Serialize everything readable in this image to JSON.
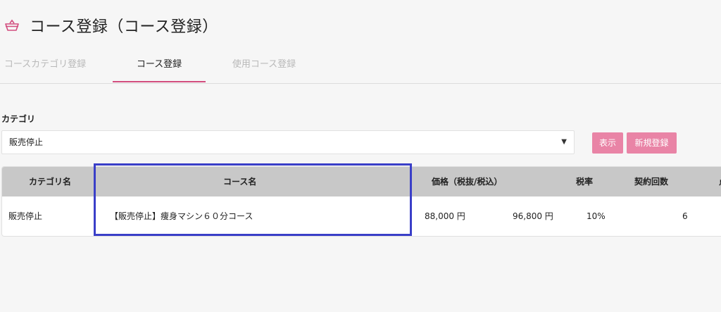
{
  "page": {
    "title": "コース登録（コース登録）"
  },
  "tabs": [
    "コースカテゴリ登録",
    "コース登録",
    "使用コース登録"
  ],
  "filter": {
    "label": "カテゴリ",
    "selected": "販売停止",
    "arrow": "▼"
  },
  "buttons": {
    "show": "表示",
    "new": "新規登録"
  },
  "table": {
    "headers": {
      "category": "カテゴリ名",
      "course": "コース名",
      "price": "価格（税抜/税込）",
      "tax_rate": "税率",
      "contracts": "契約回数",
      "cut": "点"
    },
    "row": {
      "category": "販売停止",
      "course": "【販売停止】痩身マシン６０分コース",
      "price_ex": "88,000 円",
      "price_in": "96,800 円",
      "tax_rate": "10%",
      "contracts": "6"
    }
  },
  "colors": {
    "accent": "#d24d7e",
    "button": "#e984a6",
    "highlight": "#3a3fc8"
  },
  "icons": {
    "header": "basket-icon"
  }
}
